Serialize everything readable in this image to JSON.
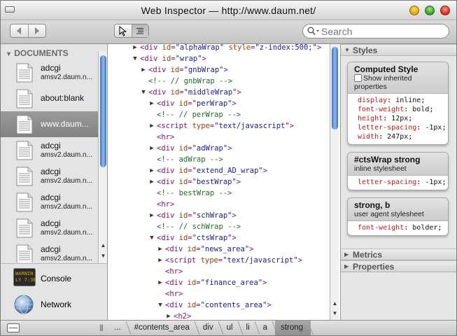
{
  "window": {
    "title": "Web Inspector — http://www.daum.net/"
  },
  "toolbar": {
    "back_icon": "back-arrow-icon",
    "forward_icon": "forward-arrow-icon",
    "search_placeholder": "Search"
  },
  "sidebar": {
    "documents_header": "DOCUMENTS",
    "documents": [
      {
        "name": "adcgi",
        "sub": "amsv2.daum.n..."
      },
      {
        "name": "about:blank",
        "sub": ""
      },
      {
        "name": "www.daum...",
        "sub": "",
        "selected": true
      },
      {
        "name": "adcgi",
        "sub": "amsv2.daum.n..."
      },
      {
        "name": "adcgi",
        "sub": "amsv2.daum.n..."
      },
      {
        "name": "adcgi",
        "sub": "amsv2.daum.n..."
      },
      {
        "name": "adcgi",
        "sub": "amsv2.daum.n..."
      },
      {
        "name": "adcgi",
        "sub": "amsv2.daum.n..."
      }
    ],
    "console_label": "Console",
    "console_icon_text": "WARNIN\nLY 7:36",
    "network_label": "Network"
  },
  "dom_tree": [
    {
      "indent": 0,
      "twisty": "right",
      "kind": "tag",
      "tag": "div",
      "attrs": [
        [
          "id",
          "\"alphaWrap\""
        ],
        [
          "style",
          "\"z-index:500;\""
        ]
      ]
    },
    {
      "indent": 0,
      "twisty": "down",
      "kind": "tag",
      "tag": "div",
      "attrs": [
        [
          "id",
          "\"wrap\""
        ]
      ]
    },
    {
      "indent": 1,
      "twisty": "right",
      "kind": "tag",
      "tag": "div",
      "attrs": [
        [
          "id",
          "\"gnbWrap\""
        ]
      ]
    },
    {
      "indent": 1,
      "twisty": "",
      "kind": "comment",
      "text": "<!-- // gnbWrap -->"
    },
    {
      "indent": 1,
      "twisty": "down",
      "kind": "tag",
      "tag": "div",
      "attrs": [
        [
          "id",
          "\"middleWrap\""
        ]
      ]
    },
    {
      "indent": 2,
      "twisty": "right",
      "kind": "tag",
      "tag": "div",
      "attrs": [
        [
          "id",
          "\"perWrap\""
        ]
      ]
    },
    {
      "indent": 2,
      "twisty": "",
      "kind": "comment",
      "text": "<!-- // perWrap -->"
    },
    {
      "indent": 2,
      "twisty": "right",
      "kind": "tag",
      "tag": "script",
      "attrs": [
        [
          "type",
          "\"text/javascript\""
        ]
      ]
    },
    {
      "indent": 2,
      "twisty": "",
      "kind": "tag",
      "tag": "hr",
      "attrs": []
    },
    {
      "indent": 2,
      "twisty": "right",
      "kind": "tag",
      "tag": "div",
      "attrs": [
        [
          "id",
          "\"adWrap\""
        ]
      ]
    },
    {
      "indent": 2,
      "twisty": "",
      "kind": "comment",
      "text": "<!-- adWrap -->"
    },
    {
      "indent": 2,
      "twisty": "right",
      "kind": "tag",
      "tag": "div",
      "attrs": [
        [
          "id",
          "\"extend_AD_wrap\""
        ]
      ]
    },
    {
      "indent": 2,
      "twisty": "right",
      "kind": "tag",
      "tag": "div",
      "attrs": [
        [
          "id",
          "\"bestWrap\""
        ]
      ]
    },
    {
      "indent": 2,
      "twisty": "",
      "kind": "comment",
      "text": "<!-- bestWrap -->"
    },
    {
      "indent": 2,
      "twisty": "",
      "kind": "tag",
      "tag": "hr",
      "attrs": []
    },
    {
      "indent": 2,
      "twisty": "right",
      "kind": "tag",
      "tag": "div",
      "attrs": [
        [
          "id",
          "\"schWrap\""
        ]
      ]
    },
    {
      "indent": 2,
      "twisty": "",
      "kind": "comment",
      "text": "<!-- // schWrap -->"
    },
    {
      "indent": 2,
      "twisty": "down",
      "kind": "tag",
      "tag": "div",
      "attrs": [
        [
          "id",
          "\"ctsWrap\""
        ]
      ]
    },
    {
      "indent": 3,
      "twisty": "right",
      "kind": "tag",
      "tag": "div",
      "attrs": [
        [
          "id",
          "\"news_area\""
        ]
      ]
    },
    {
      "indent": 3,
      "twisty": "right",
      "kind": "tag",
      "tag": "script",
      "attrs": [
        [
          "type",
          "\"text/javascript\""
        ]
      ]
    },
    {
      "indent": 3,
      "twisty": "",
      "kind": "tag",
      "tag": "hr",
      "attrs": []
    },
    {
      "indent": 3,
      "twisty": "right",
      "kind": "tag",
      "tag": "div",
      "attrs": [
        [
          "id",
          "\"finance_area\""
        ]
      ]
    },
    {
      "indent": 3,
      "twisty": "",
      "kind": "tag",
      "tag": "hr",
      "attrs": []
    },
    {
      "indent": 3,
      "twisty": "down",
      "kind": "tag",
      "tag": "div",
      "attrs": [
        [
          "id",
          "\"contents_area\""
        ]
      ]
    },
    {
      "indent": 4,
      "twisty": "right",
      "kind": "tag",
      "tag": "h2",
      "attrs": []
    }
  ],
  "styles": {
    "header": "Styles",
    "computed": {
      "title": "Computed Style",
      "checkbox_label": "Show inherited properties",
      "props": [
        {
          "name": "display",
          "value": "inline"
        },
        {
          "name": "font-weight",
          "value": "bold"
        },
        {
          "name": "height",
          "value": "12px"
        },
        {
          "name": "letter-spacing",
          "value": "-1px"
        },
        {
          "name": "width",
          "value": "247px"
        }
      ]
    },
    "rules": [
      {
        "selector": "#ctsWrap strong",
        "source": "inline stylesheet",
        "props": [
          {
            "name": "letter-spacing",
            "value": "-1px"
          }
        ]
      },
      {
        "selector": "strong, b",
        "source": "user agent stylesheet",
        "props": [
          {
            "name": "font-weight",
            "value": "bolder"
          }
        ]
      }
    ]
  },
  "metrics_header": "Metrics",
  "properties_header": "Properties",
  "breadcrumbs": [
    "...",
    "#contents_area",
    "div",
    "ul",
    "li",
    "a",
    "strong"
  ],
  "selected_crumb": "strong",
  "colors": {
    "tag": "#881280",
    "attr": "#994500",
    "value": "#1a1aa6",
    "comment": "#236e25",
    "css_property": "#c41a16"
  }
}
